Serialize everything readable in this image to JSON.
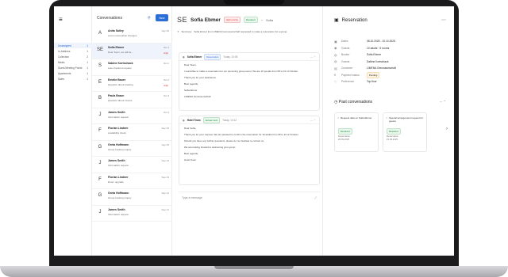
{
  "nav": {
    "menu_icon": "≡",
    "items": [
      {
        "label": "Unassigned",
        "count": "1",
        "active": true
      },
      {
        "label": "In-Address",
        "count": "1",
        "active": false
      },
      {
        "label": "Collection",
        "count": "2",
        "active": false
      },
      {
        "label": "Meals",
        "count": "1",
        "active": false
      },
      {
        "label": "Guest Meeting Points",
        "count": "1",
        "active": false
      },
      {
        "label": "Apartments",
        "count": "1",
        "active": false
      },
      {
        "label": "Sales",
        "count": "1",
        "active": false
      }
    ]
  },
  "conversations": {
    "title": "Conversations",
    "new_label": "New",
    "rows": [
      {
        "initials": "A",
        "name": "Anita Salley",
        "preview": "Lorem reservation changes",
        "date": "Sep 30",
        "tag": "",
        "selected": false
      },
      {
        "initials": "SE",
        "name": "Sofia Ebmer",
        "preview": "Dear Team, we will be...",
        "date": "Oct 1",
        "tag": "High",
        "selected": true
      },
      {
        "initials": "S",
        "name": "Sabine Kortschack",
        "preview": "Late checkout request",
        "date": "Oct 2",
        "tag": "",
        "selected": false
      },
      {
        "initials": "E",
        "name": "Emelie Bauer",
        "preview": "Question about booking",
        "date": "Oct 2",
        "tag": "High",
        "selected": false
      },
      {
        "initials": "B",
        "name": "Paula Braun",
        "preview": "Question about invoice",
        "date": "Oct 3",
        "tag": "",
        "selected": false
      },
      {
        "initials": "J",
        "name": "James Smith",
        "preview": "Information request",
        "date": "Oct 4",
        "tag": "",
        "selected": false
      },
      {
        "initials": "F",
        "name": "Florian Lindner",
        "preview": "Availability check",
        "date": "Sep 26",
        "tag": "",
        "selected": false
      },
      {
        "initials": "G",
        "name": "Greta Hoffmann",
        "preview": "Group booking inquiry",
        "date": "Sep 25",
        "tag": "",
        "selected": false
      },
      {
        "initials": "J",
        "name": "James Smith",
        "preview": "Information request",
        "date": "Sep 24",
        "tag": "",
        "selected": false
      },
      {
        "initials": "F",
        "name": "Florian Lindner",
        "preview": "Room upgrade",
        "date": "Sep 23",
        "tag": "",
        "selected": false
      },
      {
        "initials": "G",
        "name": "Greta Hoffmann",
        "preview": "Group booking inquiry",
        "date": "Sep 22",
        "tag": "",
        "selected": false
      },
      {
        "initials": "J",
        "name": "James Smith",
        "preview": "Information request",
        "date": "Sep 21",
        "tag": "",
        "selected": false
      }
    ]
  },
  "detail": {
    "initials": "SE",
    "name": "Sofia Ebmer",
    "badges": {
      "priority": "High priority",
      "status": "Resolved"
    },
    "mic_label": "Sofia",
    "summary_label": "Summary",
    "summary_text": "Sofia Ebmer from LIMENA Genossenschaft requested to make a reservation for a group.",
    "messages": [
      {
        "sender": "Sofia Ebmer",
        "badge": "Reservation",
        "date": "Today, 10:05",
        "body": [
          "Dear Team,",
          "I would like to make a reservation for our upcoming group event. We are 10 people from 08 to 10 of October.",
          "Thank you for your assistance.",
          "Best regards,",
          "Sofia Ebmer",
          "LIMENA Genossenschaft"
        ]
      },
      {
        "sender": "Hotel Team",
        "badge": "Answer sent",
        "date": "Today, 10:12",
        "body": [
          "Dear Sofia,",
          "Thank you for your request. We are pleased to confirm the reservation for 10 adults from 08 to 10 of October.",
          "Should you have any further questions, please do not hesitate to contact us.",
          "We are looking forward to welcoming your group.",
          "Best regards,",
          "Hotel Team"
        ]
      }
    ],
    "reply_placeholder": "Type a message"
  },
  "reservation": {
    "title": "Reservation",
    "fields": [
      {
        "icon": "▣",
        "label": "Dates",
        "value": "08.10.2025 - 10.10.2025"
      },
      {
        "icon": "◉",
        "label": "Guests",
        "value": "10 adults · 5 rooms"
      },
      {
        "icon": "◍",
        "label": "Booker",
        "value": "Sofia Ebmer"
      },
      {
        "icon": "◍",
        "label": "Guests",
        "value": "Sabine Kortschack"
      },
      {
        "icon": "▤",
        "label": "Customer",
        "value": "LIMENA Genossenschaft"
      },
      {
        "icon": "€",
        "label": "Payment status",
        "value": "Pending"
      },
      {
        "icon": "♡",
        "label": "Preference",
        "value": "Top floor"
      }
    ]
  },
  "past_conversations": {
    "title": "Past conversations",
    "cards": [
      {
        "title": "Request data on Sofia Ebmer",
        "status": "Resolved",
        "meta1": "Reservation",
        "meta2": "28.09.2025"
      },
      {
        "title": "Special arrangement request for guests",
        "status": "Resolved",
        "meta1": "Reservation",
        "meta2": "15.09.2025"
      }
    ]
  }
}
